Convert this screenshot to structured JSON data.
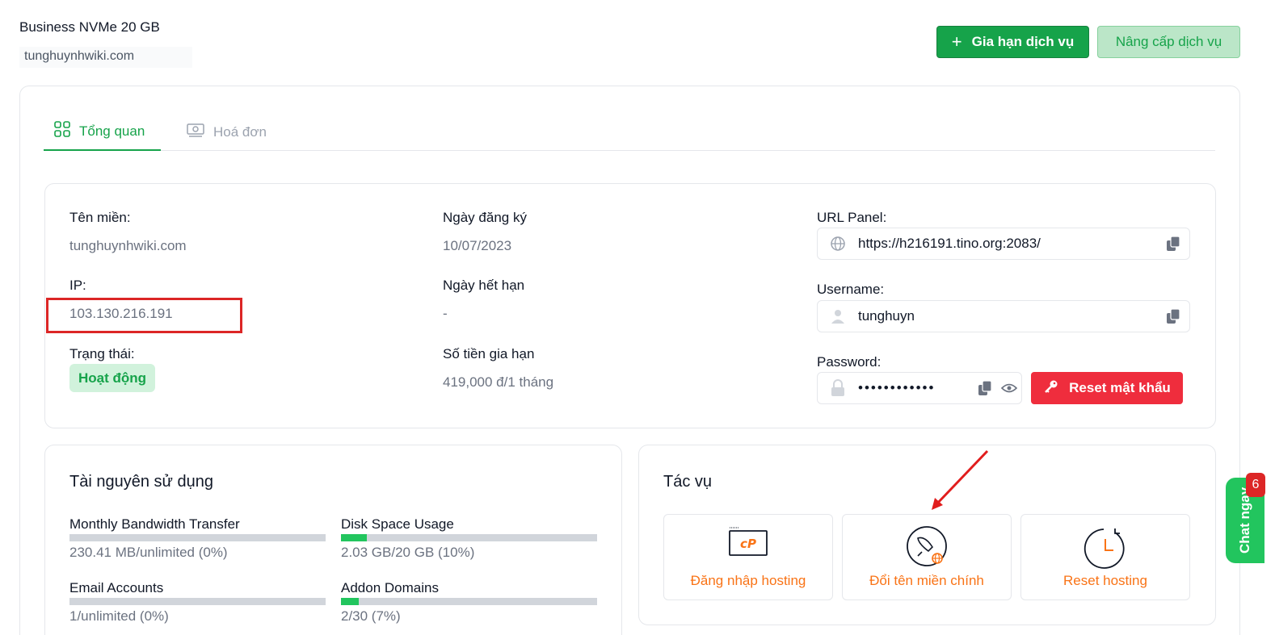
{
  "service": {
    "name": "Business NVMe 20 GB",
    "domain": "tunghuynhwiki.com"
  },
  "actions_top": {
    "renew_label": "Gia hạn dịch vụ",
    "upgrade_label": "Nâng cấp dịch vụ"
  },
  "tabs": [
    {
      "label": "Tổng quan",
      "icon": "grid-icon",
      "active": true
    },
    {
      "label": "Hoá đơn",
      "icon": "money-icon",
      "active": false
    }
  ],
  "info": {
    "domain_label": "Tên miền:",
    "domain_value": "tunghuynhwiki.com",
    "ip_label": "IP:",
    "ip_value": "103.130.216.191",
    "status_label": "Trạng thái:",
    "status_value": "Hoạt động",
    "reg_date_label": "Ngày đăng ký",
    "reg_date_value": "10/07/2023",
    "exp_date_label": "Ngày hết hạn",
    "exp_date_value": "-",
    "renew_price_label": "Số tiền gia hạn",
    "renew_price_value": "419,000 đ/1 tháng",
    "url_panel_label": "URL Panel:",
    "url_panel_value": "https://h216191.tino.org:2083/",
    "username_label": "Username:",
    "username_value": "tunghuyn",
    "password_label": "Password:",
    "password_value": "••••••••••••",
    "reset_password_label": "Reset mật khẩu"
  },
  "resources": {
    "title": "Tài nguyên sử dụng",
    "items": [
      {
        "label": "Monthly Bandwidth Transfer",
        "value": "230.41 MB/unlimited (0%)",
        "percent": 0
      },
      {
        "label": "Disk Space Usage",
        "value": "2.03 GB/20 GB (10%)",
        "percent": 10
      },
      {
        "label": "Email Accounts",
        "value": "1/unlimited (0%)",
        "percent": 0
      },
      {
        "label": "Addon Domains",
        "value": "2/30 (7%)",
        "percent": 7
      }
    ]
  },
  "tasks": {
    "title": "Tác vụ",
    "items": [
      {
        "label": "Đăng nhập hosting",
        "icon": "cpanel-icon"
      },
      {
        "label": "Đổi tên miền chính",
        "icon": "rocket-globe-icon"
      },
      {
        "label": "Reset hosting",
        "icon": "reset-clock-icon"
      }
    ]
  },
  "chat": {
    "label": "Chat ngay",
    "badge": "6"
  },
  "colors": {
    "accent": "#16a34a",
    "danger": "#dc2626",
    "task_text": "#f97316"
  }
}
